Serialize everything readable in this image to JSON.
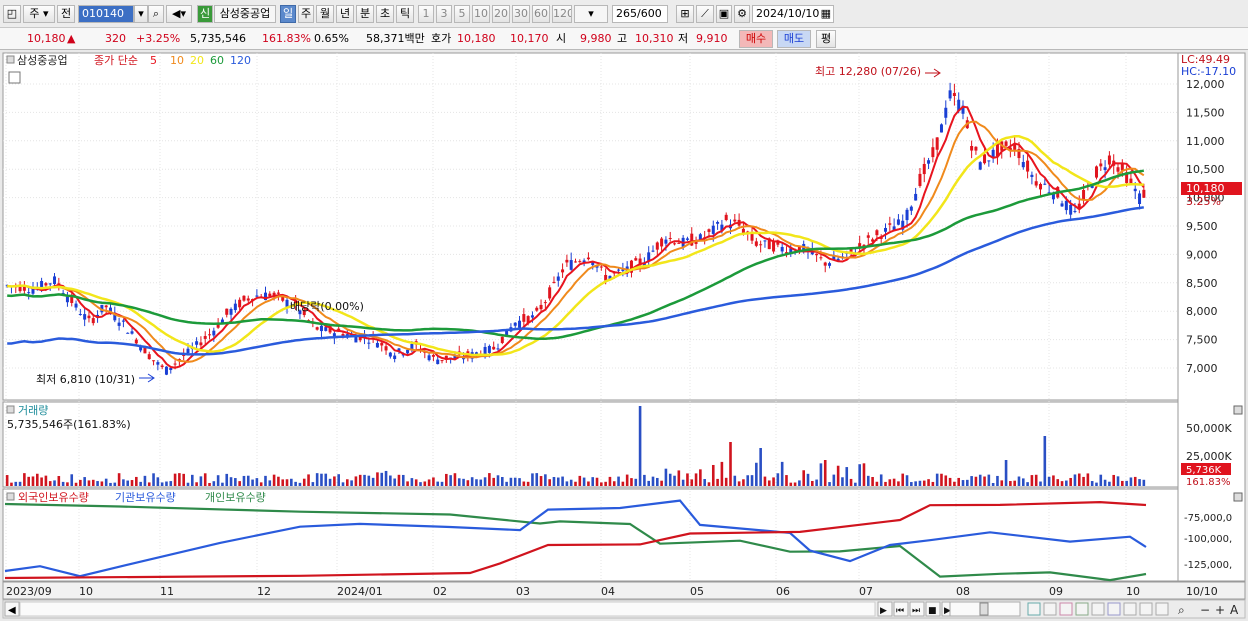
{
  "toolbar": {
    "period_options": [
      "주",
      "전"
    ],
    "code": "010140",
    "new_badge": "신",
    "stock_name": "삼성중공업",
    "intervals": [
      "일",
      "주",
      "월",
      "년",
      "분",
      "초",
      "틱"
    ],
    "minute_options": [
      "1",
      "3",
      "5",
      "10",
      "20",
      "30",
      "60",
      "120"
    ],
    "count": "265",
    "count_total": "/600",
    "date": "2024/10/10"
  },
  "quote": {
    "price": "10,180",
    "change_arrow": "▲",
    "change": "320",
    "change_pct": "+3.25%",
    "volume": "5,735,546",
    "volume_ratio": "161.83%",
    "turnover_rate": "0.65%",
    "amount": "58,371백만",
    "ask_label": "호가",
    "ask": "10,180",
    "bid": "10,170",
    "open_label": "시",
    "open": "9,980",
    "high_label": "고",
    "high": "10,310",
    "low_label": "저",
    "low": "9,910",
    "buy_button": "매수",
    "sell_button": "매도",
    "eval_button": "평"
  },
  "price_panel": {
    "stock": "삼성중공업",
    "indicator": "종가 단순",
    "ma_periods": [
      "5",
      "10",
      "20",
      "60",
      "120"
    ],
    "ma_colors": [
      "#e8141e",
      "#f08a1c",
      "#f2e61a",
      "#1c9a3a",
      "#2a5bdc"
    ],
    "lc": "LC:49.49",
    "hc": "HC:-17.10",
    "high_note": "최고 12,280 (07/26)",
    "low_note": "최저 6,810 (10/31)",
    "dividend_note": "배당락(0.00%)",
    "current_label": "10,180",
    "current_pct": "3.25%",
    "yticks": [
      "12,000",
      "11,500",
      "11,000",
      "10,500",
      "10,000",
      "9,500",
      "9,000",
      "8,500",
      "8,000",
      "7,500",
      "7,000"
    ]
  },
  "volume_panel": {
    "title": "거래량",
    "value": "5,735,546주(161.83%)",
    "yticks": [
      "50,000K",
      "25,000K"
    ],
    "current_label": "5,736K",
    "current_pct": "161.83%"
  },
  "investor_panel": {
    "series": [
      "외국인보유수량",
      "기관보유수량",
      "개인보유수량"
    ],
    "colors": [
      "#d0141e",
      "#2a5bdc",
      "#2f8a4a"
    ],
    "yticks": [
      "-75,000,0",
      "-100,000,",
      "-125,000,"
    ]
  },
  "x_axis": {
    "labels": [
      "2023/09",
      "10",
      "11",
      "12",
      "2024/01",
      "02",
      "03",
      "04",
      "05",
      "06",
      "07",
      "08",
      "09",
      "10"
    ],
    "right_label": "10/10"
  },
  "bottom_bar": {
    "buttons": [
      "▶",
      "⏮",
      "⏭",
      "■",
      "▶"
    ],
    "zoom_buttons": [
      "−",
      "+",
      "A"
    ]
  }
}
